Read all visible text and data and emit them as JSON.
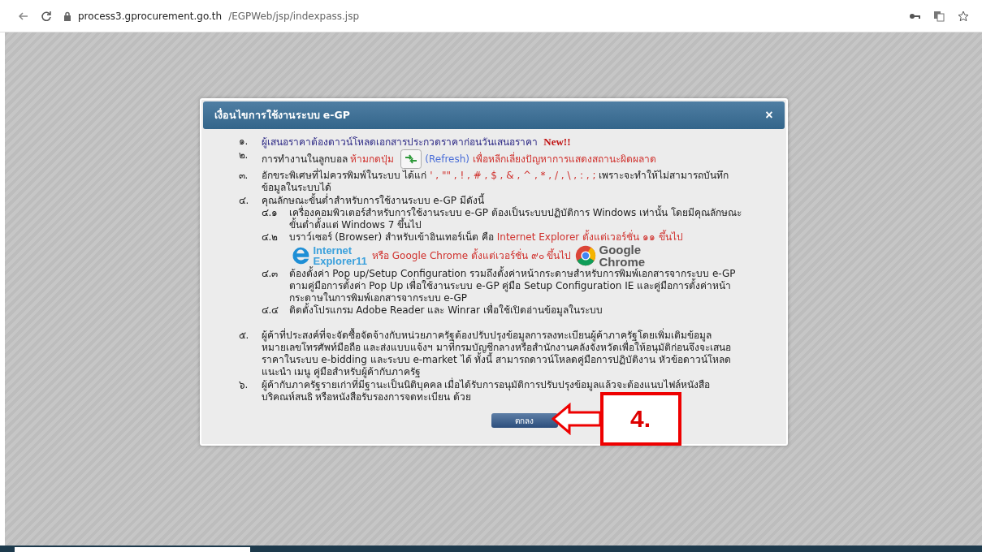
{
  "browser": {
    "url_host": "process3.gprocurement.go.th",
    "url_path": "/EGPWeb/jsp/indexpass.jsp"
  },
  "dialog": {
    "title": "เงื่อนไขการใช้งานระบบ e-GP",
    "close_label": "×",
    "items": [
      {
        "number": "๑.",
        "segments": [
          {
            "kind": "notice",
            "text": "ผู้เสนอราคาต้องดาวน์โหลดเอกสารประกวดราคาก่อนวันเสนอราคา"
          },
          {
            "kind": "new",
            "text": "New!!"
          }
        ]
      },
      {
        "number": "๒.",
        "segments": [
          {
            "kind": "plain",
            "text": "การทำงานในลูกบอล"
          },
          {
            "kind": "warning",
            "text": "ห้ามกดปุ่ม"
          },
          {
            "kind": "refresh_icon"
          },
          {
            "kind": "link",
            "text": "(Refresh)"
          },
          {
            "kind": "warning",
            "text": "เพื่อหลีกเลี่ยงปัญหาการแสดงสถานะผิดผลาด"
          }
        ]
      },
      {
        "number": "๓.",
        "segments": [
          {
            "kind": "plain",
            "text": "อักขระพิเศษที่ไม่ควรพิมพ์ในระบบ ได้แก่"
          },
          {
            "kind": "warning",
            "text": "' , \"\" , ! , # , $ , & , ^ , * , / , \\ , : , ;"
          },
          {
            "kind": "plain",
            "text": "เพราะจะทำให้ไม่สามารถบันทึกข้อมูลในระบบได้"
          }
        ]
      },
      {
        "number": "๔.",
        "segments": [
          {
            "kind": "plain",
            "text": "คุณลักษณะขั้นต่ำสำหรับการใช้งานระบบ e-GP มีดังนี้"
          }
        ],
        "children": [
          {
            "number": "๔.๑",
            "segments": [
              {
                "kind": "plain",
                "text": "เครื่องคอมพิวเตอร์สำหรับการใช้งานระบบ e-GP ต้องเป็นระบบปฏิบัติการ Windows เท่านั้น โดยมีคุณลักษณะขั้นต่ำตั้งแต่ Windows 7 ขึ้นไป"
              }
            ]
          },
          {
            "number": "๔.๒",
            "segments": [
              {
                "kind": "plain",
                "text": "บราว์เซอร์ (Browser) สำหรับเข้าอินเทอร์เน็ต คือ"
              },
              {
                "kind": "warning",
                "text": "Internet Explorer ตั้งแต่เวอร์ชั่น ๑๑ ขึ้นไป"
              },
              {
                "kind": "break"
              },
              {
                "kind": "ie_logo",
                "lines": [
                  "Internet",
                  "Explorer11"
                ]
              },
              {
                "kind": "warning",
                "text": "หรือ Google Chrome ตั้งแต่เวอร์ชั่น ๙๐ ขึ้นไป"
              },
              {
                "kind": "chrome_logo",
                "lines": [
                  "Google",
                  "Chrome"
                ]
              }
            ]
          },
          {
            "number": "๔.๓",
            "segments": [
              {
                "kind": "plain",
                "text": "ต้องตั้งค่า Pop up/Setup Configuration รวมถึงตั้งค่าหน้ากระดาษสำหรับการพิมพ์เอกสารจากระบบ e-GP ตามคู่มือการตั้งค่า Pop Up เพื่อใช้งานระบบ e-GP คู่มือ Setup Configuration IE และคู่มือการตั้งค่าหน้ากระดาษในการพิมพ์เอกสารจากระบบ e-GP"
              }
            ]
          },
          {
            "number": "๔.๔",
            "segments": [
              {
                "kind": "plain",
                "text": "ติดตั้งโปรแกรม Adobe Reader และ Winrar เพื่อใช้เปิดอ่านข้อมูลในระบบ"
              }
            ]
          }
        ]
      },
      {
        "number": "๕.",
        "segments": [
          {
            "kind": "plain",
            "text": "ผู้ค้าที่ประสงค์ที่จะจัดซื้อจัดจ้างกับหน่วยภาครัฐต้องปรับปรุงข้อมูลการลงทะเบียนผู้ค้าภาครัฐโดยเพิ่มเติมข้อมูลหมายเลขโทรศัพท์มือถือ และส่งแบบแจ้งฯ มาที่กรมบัญชีกลางหรือสำนักงานคลังจังหวัดเพื่อให้อนุมัติก่อนจึงจะเสนอราคาในระบบ e-bidding และระบบ e-market ได้ ทั้งนี้ สามารถดาวน์โหลดคู่มือการปฏิบัติงาน หัวข้อดาวน์โหลดแนะนำ เมนู คู่มือสำหรับผู้ค้ากับภาครัฐ"
          }
        ]
      },
      {
        "number": "๖.",
        "segments": [
          {
            "kind": "plain",
            "text": "ผู้ค้ากับภาครัฐรายเก่าที่มีฐานะเป็นนิติบุคคล เมื่อได้รับการอนุมัติการปรับปรุงข้อมูลแล้วจะต้องแนบไฟล์หนังสือบริคณห์สนธิ หรือหนังสือรับรองการจดทะเบียน ด้วย"
          }
        ]
      }
    ],
    "ok_button": "ตกลง"
  },
  "annotation": {
    "label": "4."
  }
}
